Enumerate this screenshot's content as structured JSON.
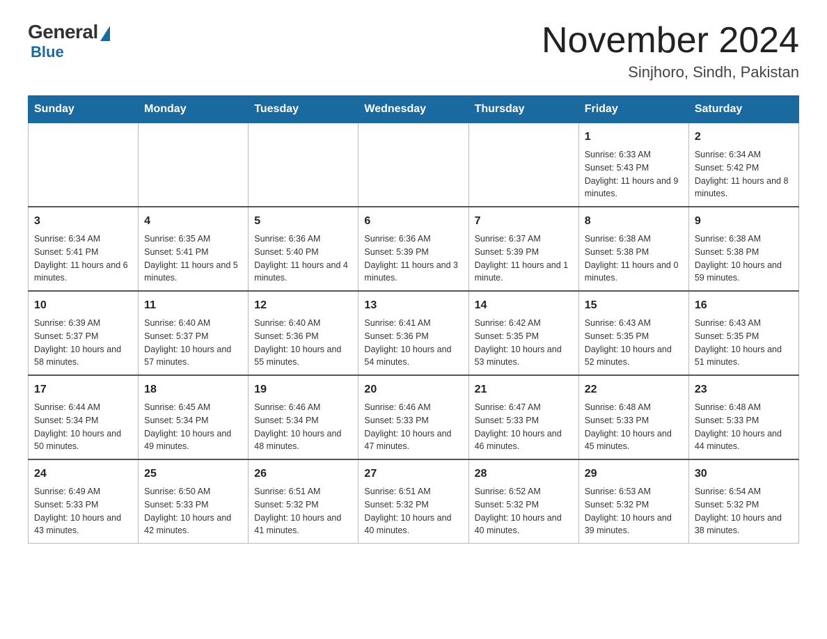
{
  "header": {
    "logo": {
      "general_text": "General",
      "blue_text": "Blue"
    },
    "title": "November 2024",
    "location": "Sinjhoro, Sindh, Pakistan"
  },
  "calendar": {
    "days_of_week": [
      "Sunday",
      "Monday",
      "Tuesday",
      "Wednesday",
      "Thursday",
      "Friday",
      "Saturday"
    ],
    "rows": [
      [
        {
          "day": "",
          "info": ""
        },
        {
          "day": "",
          "info": ""
        },
        {
          "day": "",
          "info": ""
        },
        {
          "day": "",
          "info": ""
        },
        {
          "day": "",
          "info": ""
        },
        {
          "day": "1",
          "info": "Sunrise: 6:33 AM\nSunset: 5:43 PM\nDaylight: 11 hours and 9 minutes."
        },
        {
          "day": "2",
          "info": "Sunrise: 6:34 AM\nSunset: 5:42 PM\nDaylight: 11 hours and 8 minutes."
        }
      ],
      [
        {
          "day": "3",
          "info": "Sunrise: 6:34 AM\nSunset: 5:41 PM\nDaylight: 11 hours and 6 minutes."
        },
        {
          "day": "4",
          "info": "Sunrise: 6:35 AM\nSunset: 5:41 PM\nDaylight: 11 hours and 5 minutes."
        },
        {
          "day": "5",
          "info": "Sunrise: 6:36 AM\nSunset: 5:40 PM\nDaylight: 11 hours and 4 minutes."
        },
        {
          "day": "6",
          "info": "Sunrise: 6:36 AM\nSunset: 5:39 PM\nDaylight: 11 hours and 3 minutes."
        },
        {
          "day": "7",
          "info": "Sunrise: 6:37 AM\nSunset: 5:39 PM\nDaylight: 11 hours and 1 minute."
        },
        {
          "day": "8",
          "info": "Sunrise: 6:38 AM\nSunset: 5:38 PM\nDaylight: 11 hours and 0 minutes."
        },
        {
          "day": "9",
          "info": "Sunrise: 6:38 AM\nSunset: 5:38 PM\nDaylight: 10 hours and 59 minutes."
        }
      ],
      [
        {
          "day": "10",
          "info": "Sunrise: 6:39 AM\nSunset: 5:37 PM\nDaylight: 10 hours and 58 minutes."
        },
        {
          "day": "11",
          "info": "Sunrise: 6:40 AM\nSunset: 5:37 PM\nDaylight: 10 hours and 57 minutes."
        },
        {
          "day": "12",
          "info": "Sunrise: 6:40 AM\nSunset: 5:36 PM\nDaylight: 10 hours and 55 minutes."
        },
        {
          "day": "13",
          "info": "Sunrise: 6:41 AM\nSunset: 5:36 PM\nDaylight: 10 hours and 54 minutes."
        },
        {
          "day": "14",
          "info": "Sunrise: 6:42 AM\nSunset: 5:35 PM\nDaylight: 10 hours and 53 minutes."
        },
        {
          "day": "15",
          "info": "Sunrise: 6:43 AM\nSunset: 5:35 PM\nDaylight: 10 hours and 52 minutes."
        },
        {
          "day": "16",
          "info": "Sunrise: 6:43 AM\nSunset: 5:35 PM\nDaylight: 10 hours and 51 minutes."
        }
      ],
      [
        {
          "day": "17",
          "info": "Sunrise: 6:44 AM\nSunset: 5:34 PM\nDaylight: 10 hours and 50 minutes."
        },
        {
          "day": "18",
          "info": "Sunrise: 6:45 AM\nSunset: 5:34 PM\nDaylight: 10 hours and 49 minutes."
        },
        {
          "day": "19",
          "info": "Sunrise: 6:46 AM\nSunset: 5:34 PM\nDaylight: 10 hours and 48 minutes."
        },
        {
          "day": "20",
          "info": "Sunrise: 6:46 AM\nSunset: 5:33 PM\nDaylight: 10 hours and 47 minutes."
        },
        {
          "day": "21",
          "info": "Sunrise: 6:47 AM\nSunset: 5:33 PM\nDaylight: 10 hours and 46 minutes."
        },
        {
          "day": "22",
          "info": "Sunrise: 6:48 AM\nSunset: 5:33 PM\nDaylight: 10 hours and 45 minutes."
        },
        {
          "day": "23",
          "info": "Sunrise: 6:48 AM\nSunset: 5:33 PM\nDaylight: 10 hours and 44 minutes."
        }
      ],
      [
        {
          "day": "24",
          "info": "Sunrise: 6:49 AM\nSunset: 5:33 PM\nDaylight: 10 hours and 43 minutes."
        },
        {
          "day": "25",
          "info": "Sunrise: 6:50 AM\nSunset: 5:33 PM\nDaylight: 10 hours and 42 minutes."
        },
        {
          "day": "26",
          "info": "Sunrise: 6:51 AM\nSunset: 5:32 PM\nDaylight: 10 hours and 41 minutes."
        },
        {
          "day": "27",
          "info": "Sunrise: 6:51 AM\nSunset: 5:32 PM\nDaylight: 10 hours and 40 minutes."
        },
        {
          "day": "28",
          "info": "Sunrise: 6:52 AM\nSunset: 5:32 PM\nDaylight: 10 hours and 40 minutes."
        },
        {
          "day": "29",
          "info": "Sunrise: 6:53 AM\nSunset: 5:32 PM\nDaylight: 10 hours and 39 minutes."
        },
        {
          "day": "30",
          "info": "Sunrise: 6:54 AM\nSunset: 5:32 PM\nDaylight: 10 hours and 38 minutes."
        }
      ]
    ]
  }
}
